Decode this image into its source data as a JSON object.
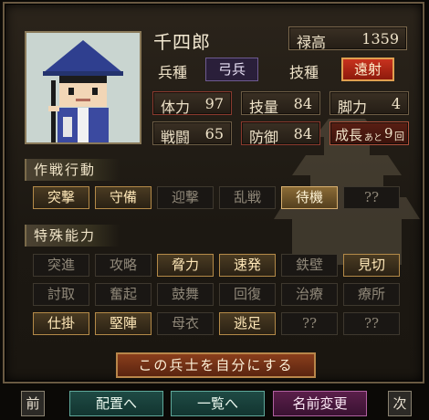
{
  "soldier": {
    "name": "千四郎",
    "stipend_label": "禄高",
    "stipend_value": "1359",
    "unit_type_label": "兵種",
    "unit_type_value": "弓兵",
    "skill_type_label": "技種",
    "skill_type_value": "遠射"
  },
  "stats": [
    {
      "label": "体力",
      "value": "97"
    },
    {
      "label": "技量",
      "value": "84"
    },
    {
      "label": "脚力",
      "value": "4"
    },
    {
      "label": "戦闘",
      "value": "65"
    },
    {
      "label": "防御",
      "value": "84"
    }
  ],
  "growth": {
    "prefix": "成長",
    "mid": "あと",
    "value": "9",
    "unit": "回"
  },
  "sections": {
    "tactics": "作戦行動",
    "abilities": "特殊能力"
  },
  "tactics": [
    {
      "label": "突撃",
      "state": "on"
    },
    {
      "label": "守備",
      "state": "on"
    },
    {
      "label": "迎撃",
      "state": "off"
    },
    {
      "label": "乱戦",
      "state": "off"
    },
    {
      "label": "待機",
      "state": "hl"
    },
    {
      "label": "??",
      "state": "off"
    }
  ],
  "abilities": [
    {
      "label": "突進",
      "state": "off"
    },
    {
      "label": "攻略",
      "state": "off"
    },
    {
      "label": "脅力",
      "state": "on"
    },
    {
      "label": "速発",
      "state": "on"
    },
    {
      "label": "鉄壁",
      "state": "off"
    },
    {
      "label": "見切",
      "state": "on"
    },
    {
      "label": "討取",
      "state": "off"
    },
    {
      "label": "奮起",
      "state": "off"
    },
    {
      "label": "鼓舞",
      "state": "off"
    },
    {
      "label": "回復",
      "state": "off"
    },
    {
      "label": "治療",
      "state": "off"
    },
    {
      "label": "療所",
      "state": "off"
    },
    {
      "label": "仕掛",
      "state": "on"
    },
    {
      "label": "堅陣",
      "state": "on"
    },
    {
      "label": "母衣",
      "state": "off"
    },
    {
      "label": "逃足",
      "state": "on"
    },
    {
      "label": "??",
      "state": "off"
    },
    {
      "label": "??",
      "state": "off"
    }
  ],
  "action_button": "この兵士を自分にする",
  "footer": {
    "prev": "前",
    "deploy": "配置へ",
    "list": "一覧へ",
    "rename": "名前変更",
    "next": "次"
  },
  "colors": {
    "frame_border": "#6a5a42",
    "highlight_red": "#c8321e",
    "teal_button": "#1f4a44",
    "magenta_button": "#5a1f4a"
  }
}
